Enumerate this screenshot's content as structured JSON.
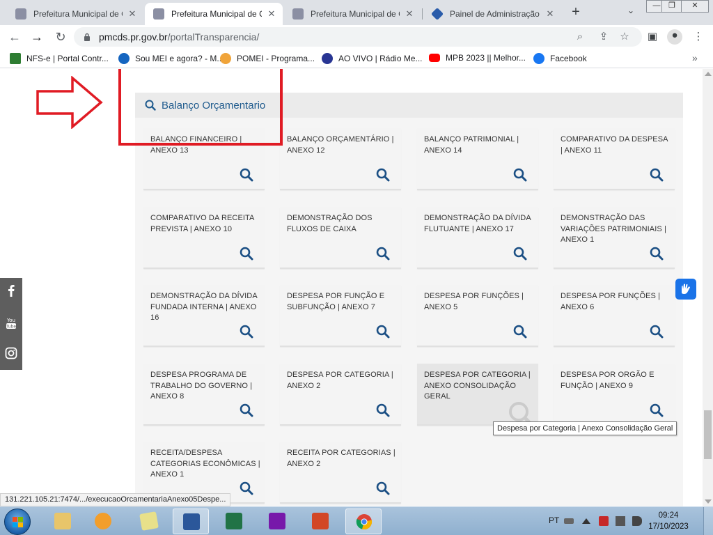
{
  "browser": {
    "tabs": [
      {
        "title": "Prefeitura Municipal de C",
        "active": false
      },
      {
        "title": "Prefeitura Municipal de C",
        "active": true
      },
      {
        "title": "Prefeitura Municipal de C",
        "active": false
      },
      {
        "title": "Painel de Administração",
        "active": false
      }
    ],
    "address": {
      "host": "pmcds.pr.gov.br",
      "path": "/portalTransparencia/"
    },
    "bookmarks": [
      {
        "label": "NFS-e | Portal Contr...",
        "icon": "nfse-icon"
      },
      {
        "label": "Sou MEI e agora? - M...",
        "icon": "mei-icon"
      },
      {
        "label": "POMEI - Programa...",
        "icon": "pomei-icon"
      },
      {
        "label": "AO VIVO | Rádio Me...",
        "icon": "radio-icon"
      },
      {
        "label": "MPB 2023 || Melhor...",
        "icon": "youtube-icon"
      },
      {
        "label": "Facebook",
        "icon": "facebook-icon"
      }
    ]
  },
  "section": {
    "title": "Balanço Orçamentario",
    "cards": [
      {
        "label": "BALANÇO FINANCEIRO | ANEXO 13"
      },
      {
        "label": "BALANÇO ORÇAMENTÁRIO | ANEXO 12"
      },
      {
        "label": "BALANÇO PATRIMONIAL | ANEXO 14"
      },
      {
        "label": "COMPARATIVO DA DESPESA | ANEXO 11"
      },
      {
        "label": "COMPARATIVO DA RECEITA PREVISTA | ANEXO 10"
      },
      {
        "label": "DEMONSTRAÇÃO DOS FLUXOS DE CAIXA"
      },
      {
        "label": "DEMONSTRAÇÃO DA DÍVIDA FLUTUANTE | ANEXO 17"
      },
      {
        "label": "DEMONSTRAÇÃO DAS VARIAÇÕES PATRIMONIAIS | ANEXO 1"
      },
      {
        "label": "DEMONSTRAÇÃO DA DÍVIDA FUNDADA INTERNA | ANEXO 16"
      },
      {
        "label": "DESPESA POR FUNÇÃO E SUBFUNÇÃO | ANEXO 7"
      },
      {
        "label": "DESPESA POR FUNÇÕES | ANEXO 5"
      },
      {
        "label": "DESPESA POR FUNÇÕES | ANEXO 6"
      },
      {
        "label": "DESPESA PROGRAMA DE TRABALHO DO GOVERNO | ANEXO 8"
      },
      {
        "label": "DESPESA POR CATEGORIA | ANEXO 2"
      },
      {
        "label": "DESPESA POR CATEGORIA | ANEXO CONSOLIDAÇÃO GERAL",
        "hovered": true
      },
      {
        "label": "DESPESA POR ORGÃO E FUNÇÃO | ANEXO 9"
      },
      {
        "label": "RECEITA/DESPESA CATEGORIAS ECONÔMICAS | ANEXO 1"
      },
      {
        "label": "RECEITA POR CATEGORIAS | ANEXO 2"
      }
    ]
  },
  "tooltip": "Despesa por Categoria | Anexo Consolidação Geral",
  "status_url": "131.221.105.21:7474/.../execucaoOrcamentariaAnexo05Despe...",
  "social_icons": [
    "facebook-icon",
    "youtube-icon",
    "instagram-icon"
  ],
  "taskbar": {
    "language": "PT",
    "time": "09:24",
    "date": "17/10/2023",
    "apps": [
      "explorer-icon",
      "media-player-icon",
      "notes-icon",
      "word-icon",
      "excel-icon",
      "onenote-icon",
      "powerpoint-icon",
      "chrome-icon"
    ]
  },
  "colors": {
    "accent": "#1e5a8d",
    "magnifier": "#1b4f84",
    "annotation_red": "#e01b24"
  }
}
